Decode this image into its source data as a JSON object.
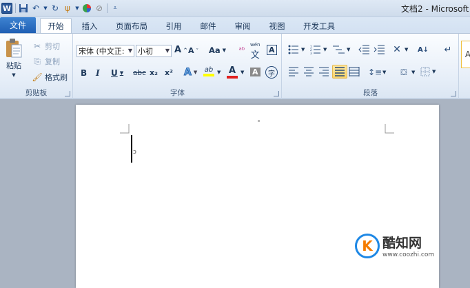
{
  "titlebar": {
    "title": "文档2 - Microsoft",
    "qat_icons": [
      "word-logo",
      "save-icon",
      "undo-icon",
      "redo-icon",
      "format-painter-icon",
      "color-icon",
      "draw-icon",
      "customize-icon"
    ],
    "word_glyph": "W"
  },
  "tabs": {
    "file": "文件",
    "items": [
      "开始",
      "插入",
      "页面布局",
      "引用",
      "邮件",
      "审阅",
      "视图",
      "开发工具"
    ],
    "active": "开始"
  },
  "clipboard": {
    "paste": "粘贴",
    "cut": "剪切",
    "copy": "复制",
    "format_painter": "格式刷",
    "label": "剪贴板"
  },
  "font": {
    "font_name": "宋体 (中文正:",
    "font_size": "小初",
    "grow": "A",
    "shrink": "A",
    "change_case": "Aa",
    "phonetic": "wén",
    "char_border": "A",
    "bold": "B",
    "italic": "I",
    "underline": "U",
    "strike": "abc",
    "subscript": "x₂",
    "superscript": "x²",
    "text_effect": "A",
    "highlight": "ab",
    "font_color": "A",
    "char_shading": "A",
    "enclose": "字",
    "label": "字体"
  },
  "paragraph": {
    "label": "段落"
  },
  "styles": {
    "preview": "A"
  },
  "watermark": {
    "logo_glyph": "K",
    "site_name": "酷知网",
    "site_url": "www.coozhi.com"
  },
  "colors": {
    "file_tab": "#2a6cc4",
    "highlight_yellow": "#ffff00",
    "font_red": "#e02020",
    "selected_button": "#f9d36a"
  }
}
